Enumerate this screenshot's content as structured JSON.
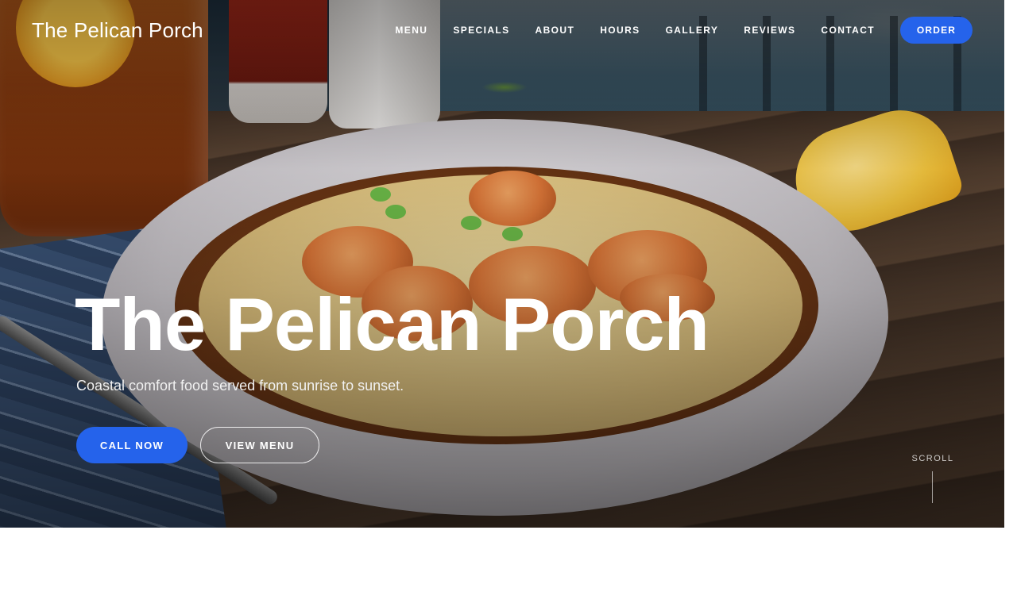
{
  "header": {
    "logo": "The Pelican Porch",
    "nav": [
      "MENU",
      "SPECIALS",
      "ABOUT",
      "HOURS",
      "GALLERY",
      "REVIEWS",
      "CONTACT"
    ],
    "order_label": "ORDER"
  },
  "hero": {
    "title": "The Pelican Porch",
    "subtitle": "Coastal comfort food served from sunrise to sunset.",
    "call_label": "CALL NOW",
    "menu_label": "VIEW MENU",
    "scroll_label": "SCROLL",
    "image_subject": "shrimp and grits bowl on wooden table by the water"
  },
  "colors": {
    "accent": "#2563eb",
    "text_on_image": "#ffffff"
  }
}
